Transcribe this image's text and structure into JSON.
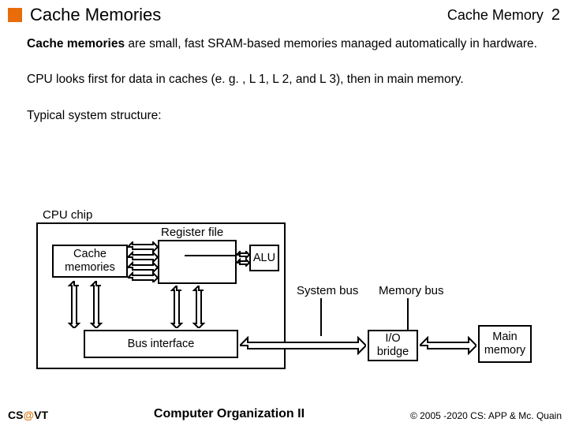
{
  "header": {
    "title": "Cache Memories",
    "topic": "Cache Memory",
    "page_number": "2"
  },
  "paragraphs": {
    "p1a": "Cache memories",
    "p1b": " are small, fast SRAM-based memories managed automatically in hardware.",
    "p2": "CPU looks first for data in caches (e. g. , L 1, L 2, and L 3), then in main memory.",
    "p3": "Typical system structure:"
  },
  "diagram": {
    "cpu_chip_label": "CPU chip",
    "regfile_label": "Register file",
    "cache_box": "Cache memories",
    "alu_box": "ALU",
    "bus_interface": "Bus interface",
    "system_bus": "System bus",
    "memory_bus": "Memory bus",
    "io_bridge": "I/O bridge",
    "main_memory": "Main memory"
  },
  "footer": {
    "left_a": "CS",
    "left_at": "@",
    "left_b": "VT",
    "center": "Computer Organization II",
    "right": "© 2005 -2020 CS: APP & Mc. Quain"
  }
}
